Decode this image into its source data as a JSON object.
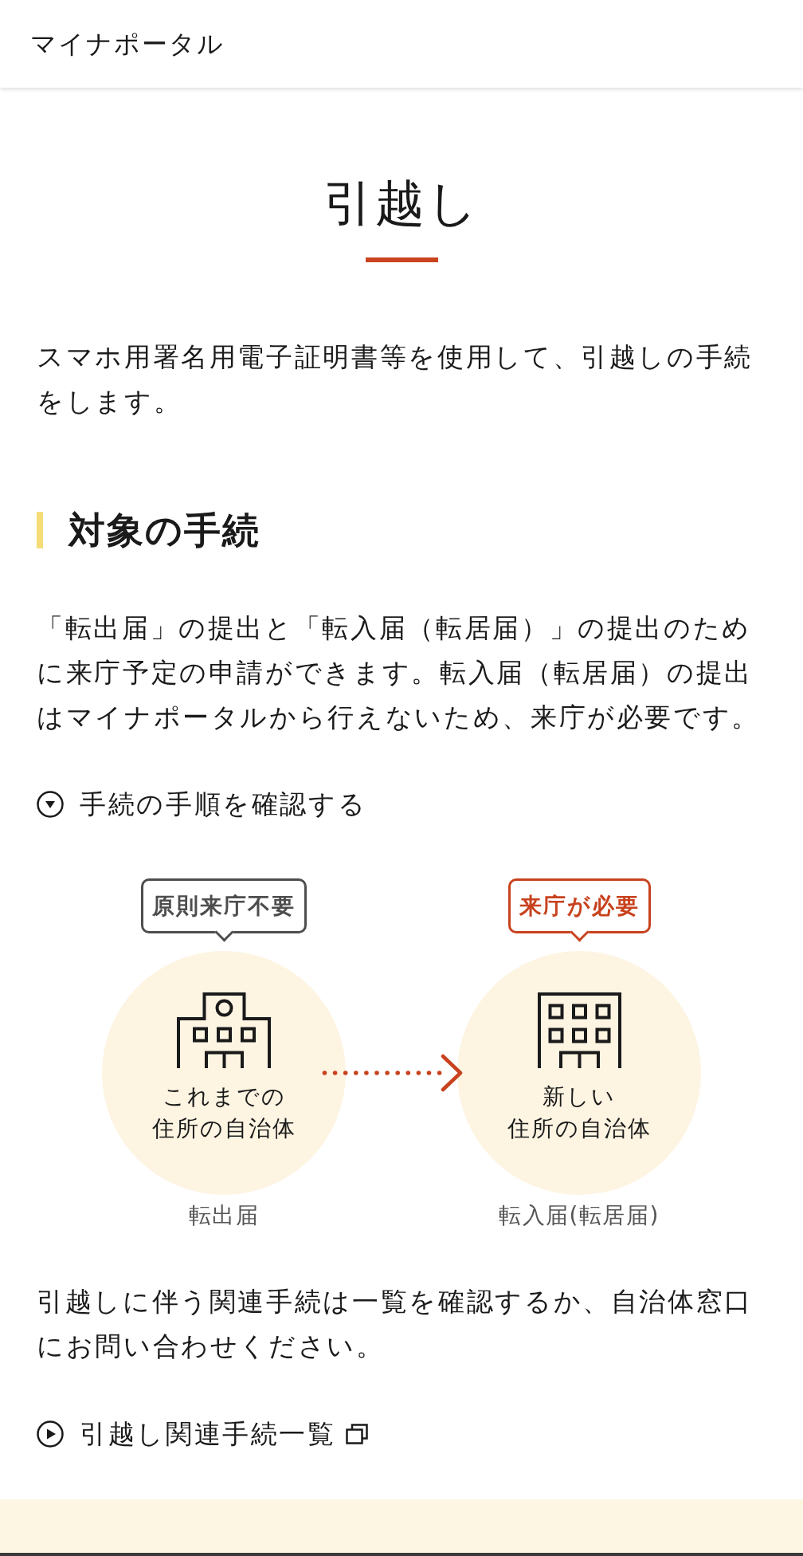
{
  "header": {
    "title": "マイナポータル"
  },
  "page": {
    "title": "引越し",
    "intro": "スマホ用署名用電子証明書等を使用して、引越しの手続をします。"
  },
  "section": {
    "heading": "対象の手続",
    "description": "「転出届」の提出と「転入届（転居届）」の提出のために来庁予定の申請ができます。転入届（転居届）の提出はマイナポータルから行えないため、来庁が必要です。",
    "steps_toggle": {
      "label": "手続の手順を確認する",
      "expanded": false
    },
    "diagram": {
      "nodes": [
        {
          "kind": "origin",
          "callout": "原則来庁不要",
          "color": "#4d4d4d",
          "caption_lines": [
            "これまでの",
            "住所の自治体"
          ],
          "label": "転出届"
        },
        {
          "kind": "destination",
          "callout": "来庁が必要",
          "color": "#c8421e",
          "caption_lines": [
            "新しい",
            "住所の自治体"
          ],
          "label": "転入届(転居届)"
        }
      ]
    },
    "note": "引越しに伴う関連手続は一覧を確認するか、自治体窓口にお問い合わせください。",
    "related_link": {
      "label": "引越し関連手続一覧",
      "external": true
    }
  }
}
